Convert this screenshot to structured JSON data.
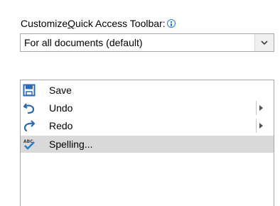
{
  "customize": {
    "label_prefix": "Customize ",
    "label_accel": "Q",
    "label_suffix": "uick Access Toolbar:"
  },
  "scope_select": {
    "selected": "For all documents (default)"
  },
  "commands": [
    {
      "label": "Save",
      "icon": "save-icon",
      "submenu": false,
      "selected": false
    },
    {
      "label": "Undo",
      "icon": "undo-icon",
      "submenu": true,
      "selected": false
    },
    {
      "label": "Redo",
      "icon": "redo-icon",
      "submenu": true,
      "selected": false
    },
    {
      "label": "Spelling...",
      "icon": "spelling-icon",
      "submenu": false,
      "selected": true
    }
  ],
  "colors": {
    "accent_blue": "#2b7cd3",
    "selection_gray": "#d9d9d9",
    "border_gray": "#a6a6a6"
  }
}
